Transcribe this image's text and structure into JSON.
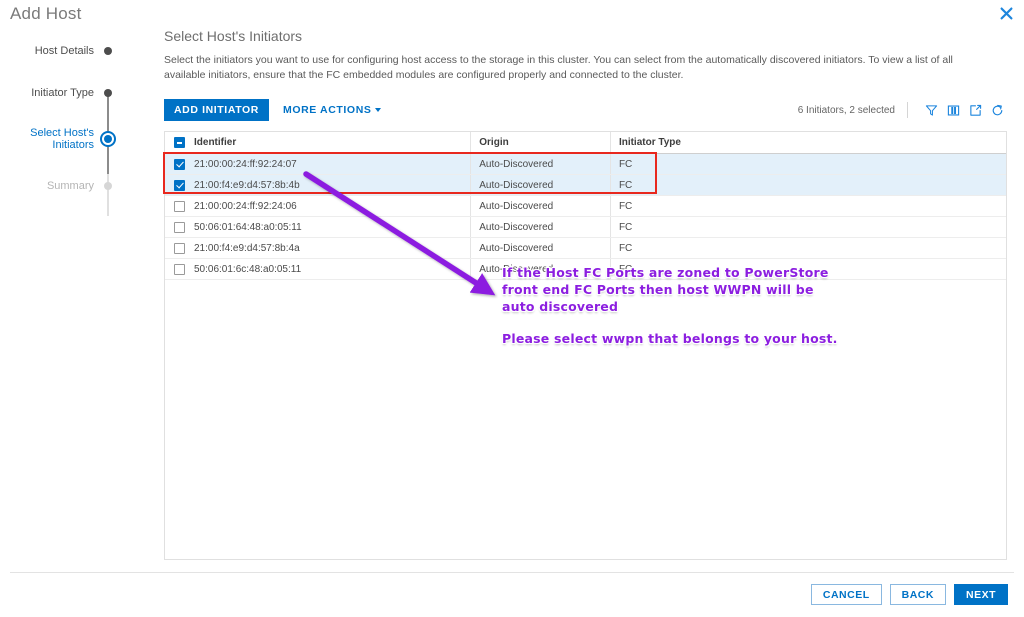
{
  "dialog": {
    "title": "Add Host",
    "close_icon": "close-icon"
  },
  "stepper": {
    "steps": [
      {
        "label": "Host Details",
        "state": "complete"
      },
      {
        "label": "Initiator Type",
        "state": "complete"
      },
      {
        "label": "Select Host's\nInitiators",
        "state": "active"
      },
      {
        "label": "Summary",
        "state": "pending"
      }
    ]
  },
  "content": {
    "section_title": "Select Host's Initiators",
    "description": "Select the initiators you want to use for configuring host access to the storage in this cluster. You can select from the automatically discovered initiators. To view a list of all available initiators, ensure that the FC embedded modules are configured properly and connected to the cluster."
  },
  "toolbar": {
    "add_initiator_label": "ADD INITIATOR",
    "more_actions_label": "MORE ACTIONS",
    "selection_count": "6 Initiators, 2 selected",
    "icons": [
      "filter-icon",
      "columns-icon",
      "export-icon",
      "refresh-icon"
    ]
  },
  "table": {
    "columns": [
      "Identifier",
      "Origin",
      "Initiator Type"
    ],
    "header_checkbox_state": "indeterminate",
    "rows": [
      {
        "identifier": "21:00:00:24:ff:92:24:07",
        "origin": "Auto-Discovered",
        "initiator_type": "FC",
        "selected": true
      },
      {
        "identifier": "21:00:f4:e9:d4:57:8b:4b",
        "origin": "Auto-Discovered",
        "initiator_type": "FC",
        "selected": true
      },
      {
        "identifier": "21:00:00:24:ff:92:24:06",
        "origin": "Auto-Discovered",
        "initiator_type": "FC",
        "selected": false
      },
      {
        "identifier": "50:06:01:64:48:a0:05:11",
        "origin": "Auto-Discovered",
        "initiator_type": "FC",
        "selected": false
      },
      {
        "identifier": "21:00:f4:e9:d4:57:8b:4a",
        "origin": "Auto-Discovered",
        "initiator_type": "FC",
        "selected": false
      },
      {
        "identifier": "50:06:01:6c:48:a0:05:11",
        "origin": "Auto-Discovered",
        "initiator_type": "FC",
        "selected": false
      }
    ]
  },
  "annotations": {
    "line_1": "If the Host FC Ports are zoned to PowerStore front end FC Ports then host WWPN will be auto discovered",
    "line_2": "Please select wwpn that belongs to your host.",
    "arrow_color": "#8c1ee0",
    "highlight_color": "#e8281e"
  },
  "footer": {
    "cancel_label": "CANCEL",
    "back_label": "BACK",
    "next_label": "NEXT"
  }
}
